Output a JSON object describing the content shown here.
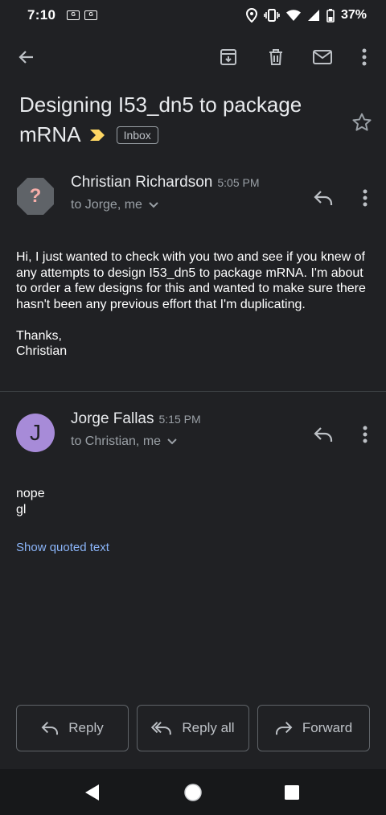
{
  "status_bar": {
    "time": "7:10",
    "battery": "37%",
    "notif_icon_text": "G"
  },
  "toolbar": {
    "icons": [
      "back-arrow-icon",
      "archive-icon",
      "delete-icon",
      "mark-unread-icon",
      "more-vert-icon"
    ]
  },
  "email": {
    "subject_line1": "Designing I53_dn5 to package",
    "subject_line2": "mRNA",
    "label": "Inbox",
    "messages": [
      {
        "sender": "Christian Richardson",
        "time": "5:05 PM",
        "recipients": "to Jorge, me",
        "avatar_text": "?",
        "body": [
          "Hi, I just wanted to check with you two and see if you knew of any attempts to design I53_dn5 to package mRNA. I'm about to order a few designs for this and wanted to make sure there hasn't been any previous effort that I'm duplicating.",
          "Thanks,",
          "Christian"
        ]
      },
      {
        "sender": "Jorge Fallas",
        "time": "5:15 PM",
        "recipients": "to Christian, me",
        "avatar_text": "J",
        "body": [
          "nope",
          "gl"
        ],
        "show_quoted": "Show quoted text"
      }
    ]
  },
  "actions": {
    "reply": "Reply",
    "reply_all": "Reply all",
    "forward": "Forward"
  },
  "colors": {
    "background": "#202124",
    "link": "#8ab4f8",
    "avatar_j": "#a78bd8",
    "important_marker": "#fdd663"
  }
}
